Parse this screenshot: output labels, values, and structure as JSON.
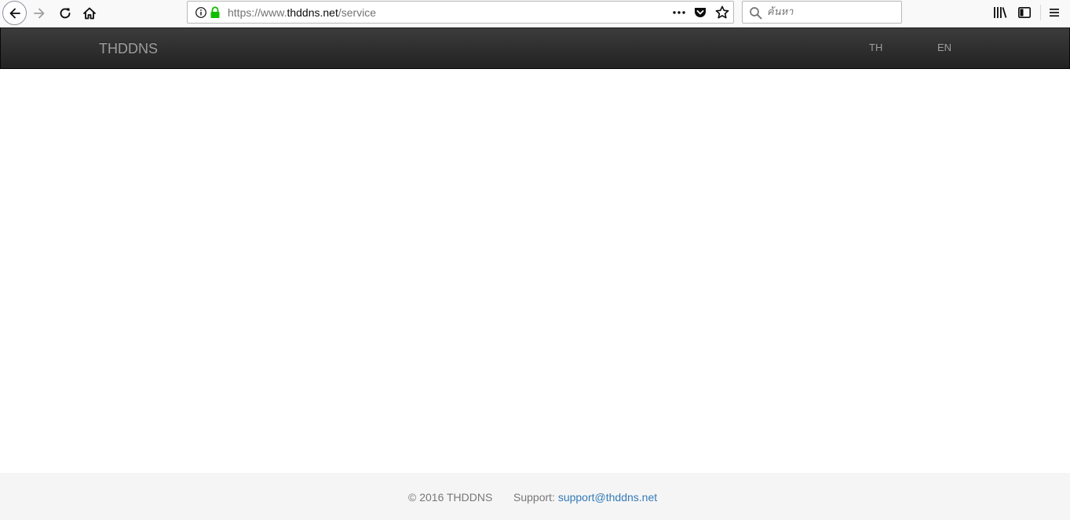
{
  "browser": {
    "url_prefix": "https://www.",
    "url_domain": "thddns.net",
    "url_path": "/service",
    "search_placeholder": "ค้นหา"
  },
  "navbar": {
    "brand": "THDDNS",
    "lang_th": "TH",
    "lang_en": "EN"
  },
  "footer": {
    "copyright": "© 2016 THDDNS",
    "support_label": "Support:",
    "support_email": "support@thddns.net"
  },
  "colors": {
    "navbar_bg": "#222222",
    "navbar_text": "#9d9d9d",
    "footer_bg": "#f5f5f5",
    "link": "#337ab7",
    "lock_green": "#12bc00"
  }
}
